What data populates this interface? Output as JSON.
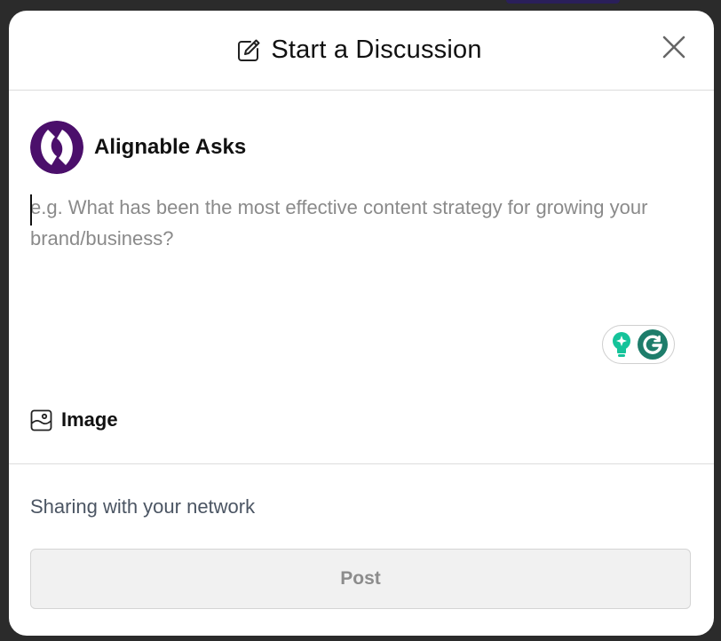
{
  "modal": {
    "title": "Start a Discussion",
    "title_icon": "edit-icon",
    "close_icon": "close-icon"
  },
  "author": {
    "name": "Alignable Asks",
    "avatar_icon": "alignable-logo",
    "avatar_color": "#4b0f6b"
  },
  "editor": {
    "placeholder": "e.g. What has been the most effective content strategy for growing your brand/business?",
    "value": ""
  },
  "grammarly": {
    "icons": [
      "lightbulb-icon",
      "grammarly-icon"
    ],
    "accent": "#15c39a",
    "brand": "#1e7d6b"
  },
  "attachments": {
    "image_label": "Image",
    "image_icon": "image-icon"
  },
  "footer": {
    "sharing_text": "Sharing with your network",
    "post_label": "Post"
  }
}
